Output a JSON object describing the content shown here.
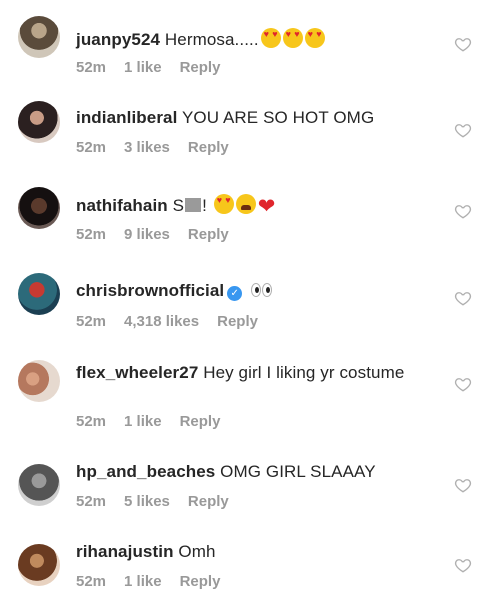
{
  "comments": [
    {
      "user": "juanpy524",
      "text": "Hermosa.....",
      "emojis": [
        "heart-eyes",
        "heart-eyes",
        "heart-eyes"
      ],
      "time": "52m",
      "likes": "1 like",
      "reply": "Reply"
    },
    {
      "user": "indianliberal",
      "text": "YOU ARE SO HOT OMG",
      "time": "52m",
      "likes": "3 likes",
      "reply": "Reply"
    },
    {
      "user": "nathifahain",
      "text_before": "S",
      "text_after": "!",
      "emojis": [
        "heart-eyes",
        "weary-face",
        "red-heart"
      ],
      "time": "52m",
      "likes": "9 likes",
      "reply": "Reply"
    },
    {
      "user": "chrisbrownofficial",
      "verified": true,
      "emojis": [
        "eyes"
      ],
      "time": "52m",
      "likes": "4,318 likes",
      "reply": "Reply"
    },
    {
      "user": "flex_wheeler27",
      "text": "Hey girl I liking yr costume",
      "time": "52m",
      "likes": "1 like",
      "reply": "Reply"
    },
    {
      "user": "hp_and_beaches",
      "text": "OMG GIRL SLAAAY",
      "time": "52m",
      "likes": "5 likes",
      "reply": "Reply"
    },
    {
      "user": "rihanajustin",
      "text": "Omh",
      "time": "52m",
      "likes": "1 like",
      "reply": "Reply"
    }
  ]
}
